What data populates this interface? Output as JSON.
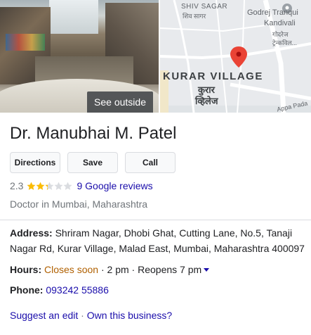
{
  "photo": {
    "see_outside_label": "See outside"
  },
  "map": {
    "labels": {
      "shiv_sagar": "SHIV SAGAR",
      "shiv_sagar_hi": "शिव सागर",
      "godrej_tranquil": "Godrej Tranqui",
      "kandivali": "Kandivali",
      "godrej_hi": "गोदरेज",
      "tren": "ट्रेन्कविल...",
      "kurar_village": "KURAR VILLAGE",
      "kurar_hi_1": "कुरार",
      "kurar_hi_2": "व्हिलेज",
      "appa_pada": "Appa Pada"
    },
    "pin_color": "#ea4335"
  },
  "business": {
    "name": "Dr. Manubhai M. Patel",
    "actions": {
      "directions": "Directions",
      "save": "Save",
      "call": "Call"
    },
    "rating": {
      "value_text": "2.3",
      "value": 2.3,
      "max": 5,
      "reviews_link": "9 Google reviews",
      "star_color": "#fbbc04",
      "empty_star_color": "#dadce0"
    },
    "category": "Doctor in Mumbai, Maharashtra",
    "address": {
      "label": "Address:",
      "value": "Shriram Nagar, Dhobi Ghat, Cutting Lane, No.5, Tanaji Nagar Rd, Kurar Village, Malad East, Mumbai, Maharashtra 400097"
    },
    "hours": {
      "label": "Hours:",
      "status": "Closes soon",
      "separator": " · ",
      "close_time": "2 pm",
      "reopens": "Reopens 7 pm",
      "status_color": "#b06000"
    },
    "phone": {
      "label": "Phone:",
      "value": "093242 55886"
    },
    "footer": {
      "suggest_edit": "Suggest an edit",
      "separator": " · ",
      "own_business": "Own this business?"
    }
  },
  "colors": {
    "link": "#1a0dab",
    "text": "#202124",
    "muted": "#70757a"
  }
}
